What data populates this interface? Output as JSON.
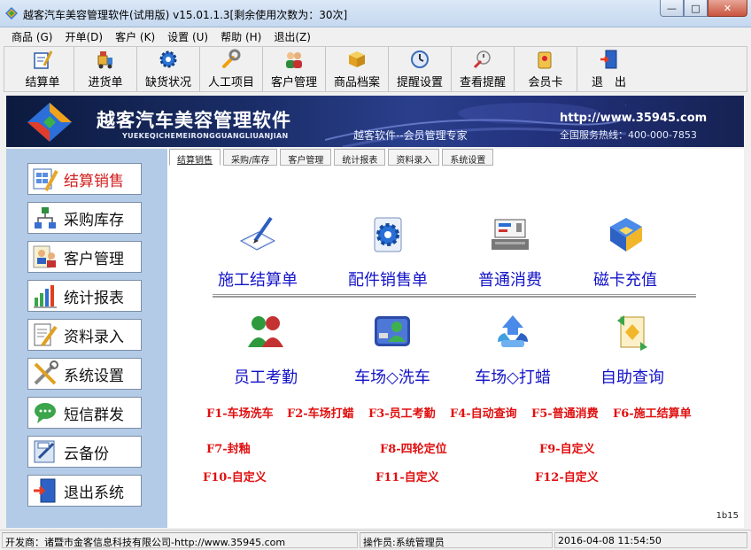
{
  "window": {
    "title": "越客汽车美容管理软件(试用版) v15.01.1.3[剩余使用次数为：30次]",
    "minimize": "—",
    "maximize": "□",
    "close": "✕"
  },
  "menu": [
    {
      "label": "商品 (G)"
    },
    {
      "label": "开单(D)"
    },
    {
      "label": "客户 (K)"
    },
    {
      "label": "设置 (U)"
    },
    {
      "label": "帮助 (H)"
    },
    {
      "label": "退出(Z)"
    }
  ],
  "toolbar": [
    {
      "label": "结算单",
      "icon": "checkout-icon"
    },
    {
      "label": "进货单",
      "icon": "forklift-icon"
    },
    {
      "label": "缺货状况",
      "icon": "gear-icon"
    },
    {
      "label": "人工项目",
      "icon": "wrench-icon"
    },
    {
      "label": "客户管理",
      "icon": "users-icon"
    },
    {
      "label": "商品档案",
      "icon": "box-icon"
    },
    {
      "label": "提醒设置",
      "icon": "clock-icon"
    },
    {
      "label": "查看提醒",
      "icon": "reminder-icon"
    },
    {
      "label": "会员卡",
      "icon": "card-icon"
    },
    {
      "label": "退　出",
      "icon": "exit-door-icon"
    }
  ],
  "banner": {
    "name": "越客汽车美容管理软件",
    "pinyin": "YUEKEQICHEMEIRONGGUANGLIUANJIAN",
    "slogan": "越客软件--会员管理专家",
    "url": "http://www.35945.com",
    "hotline": "全国服务热线：400-000-7853"
  },
  "sidebar": [
    {
      "label": "结算销售",
      "icon": "checkout-pencil-icon",
      "active": true
    },
    {
      "label": "采购库存",
      "icon": "network-icon",
      "active": false
    },
    {
      "label": "客户管理",
      "icon": "customers-icon",
      "active": false
    },
    {
      "label": "统计报表",
      "icon": "bar-chart-icon",
      "active": false
    },
    {
      "label": "资料录入",
      "icon": "edit-document-icon",
      "active": false
    },
    {
      "label": "系统设置",
      "icon": "tools-icon",
      "active": false
    },
    {
      "label": "短信群发",
      "icon": "sms-icon",
      "active": false
    },
    {
      "label": "云备份",
      "icon": "cloud-backup-icon",
      "active": false
    },
    {
      "label": "退出系统",
      "icon": "exit-door-icon",
      "active": false
    }
  ],
  "tabs": [
    {
      "label": "结算销售",
      "active": true
    },
    {
      "label": "采购/库存",
      "active": false
    },
    {
      "label": "客户管理",
      "active": false
    },
    {
      "label": "统计报表",
      "active": false
    },
    {
      "label": "资料录入",
      "active": false
    },
    {
      "label": "系统设置",
      "active": false
    }
  ],
  "tiles_row1": [
    {
      "label": "施工结算单",
      "icon": "work-order-icon"
    },
    {
      "label": "配件销售单",
      "icon": "parts-gear-icon"
    },
    {
      "label": "普通消费",
      "icon": "cash-register-icon"
    },
    {
      "label": "磁卡充值",
      "icon": "card-recharge-icon"
    }
  ],
  "tiles_row2": [
    {
      "label": "员工考勤",
      "icon": "staff-icon"
    },
    {
      "label": "车场◇洗车",
      "icon": "car-wash-icon"
    },
    {
      "label": "车场◇打蜡",
      "icon": "recycle-wax-icon"
    },
    {
      "label": "自助查询",
      "icon": "self-query-icon"
    }
  ],
  "fkeys_row1": [
    "F1-车场洗车",
    "F2-车场打蜡",
    "F3-员工考勤",
    "F4-自动查询",
    "F5-普通消费",
    "F6-施工结算单"
  ],
  "fkeys_row2": [
    "F7-封釉",
    "F8-四轮定位",
    "F9-自定义"
  ],
  "fkeys_row3": [
    "F10-自定义",
    "F11-自定义",
    "F12-自定义"
  ],
  "version_tag": "1b15",
  "status": {
    "developer": "开发商：诸暨市金客信息科技有限公司-http://www.35945.com",
    "operator": "操作员:系统管理员",
    "datetime": "2016-04-08 11:54:50"
  },
  "colors": {
    "sidebar_bg": "#b3cbe6",
    "tile_label": "#1313c8",
    "fkey_text": "#e01010",
    "active_sidebar_label": "#d21d1d",
    "banner_bg": "#1b2e6a"
  }
}
